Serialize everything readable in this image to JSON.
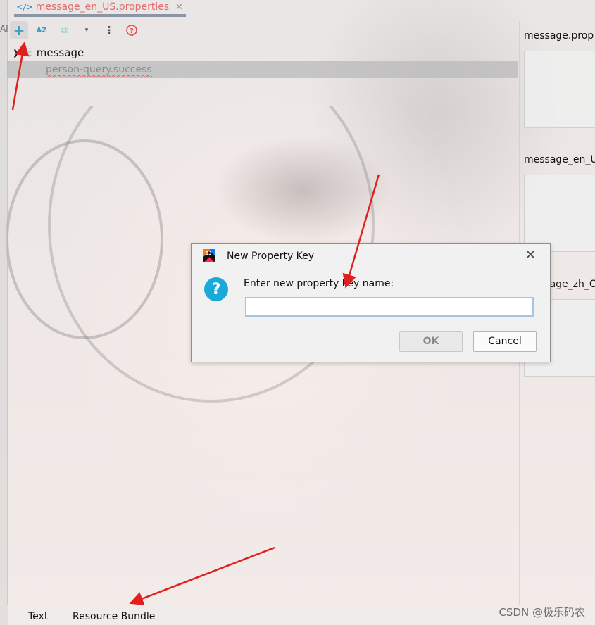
{
  "file_tab": {
    "code_icon": "</>",
    "name": "message_en_US.properties",
    "close": "✕"
  },
  "toolbar": {
    "add": "+",
    "sort": "A̵Z",
    "tag": "⧉",
    "dropdown": "▾",
    "more": "⋮",
    "help": "?"
  },
  "tree": {
    "root_label": "message",
    "child_label": "person-query.success"
  },
  "right_panel": {
    "labels": [
      "message.prop",
      "message_en_U",
      "ssage_zh_C"
    ]
  },
  "bottom_tabs": {
    "text": "Text",
    "resource_bundle": "Resource Bundle"
  },
  "left_strip_char": "Al",
  "dialog": {
    "title": "New Property Key",
    "logo_text": "IJ",
    "close": "✕",
    "question_icon": "?",
    "prompt": "Enter new property key name:",
    "input_value": "",
    "ok_label": "OK",
    "cancel_label": "Cancel"
  },
  "watermark": "CSDN @极乐码农",
  "colors": {
    "arrow": "#e0201e",
    "accent": "#1aa9d8",
    "tab_text": "#e06c6c"
  }
}
